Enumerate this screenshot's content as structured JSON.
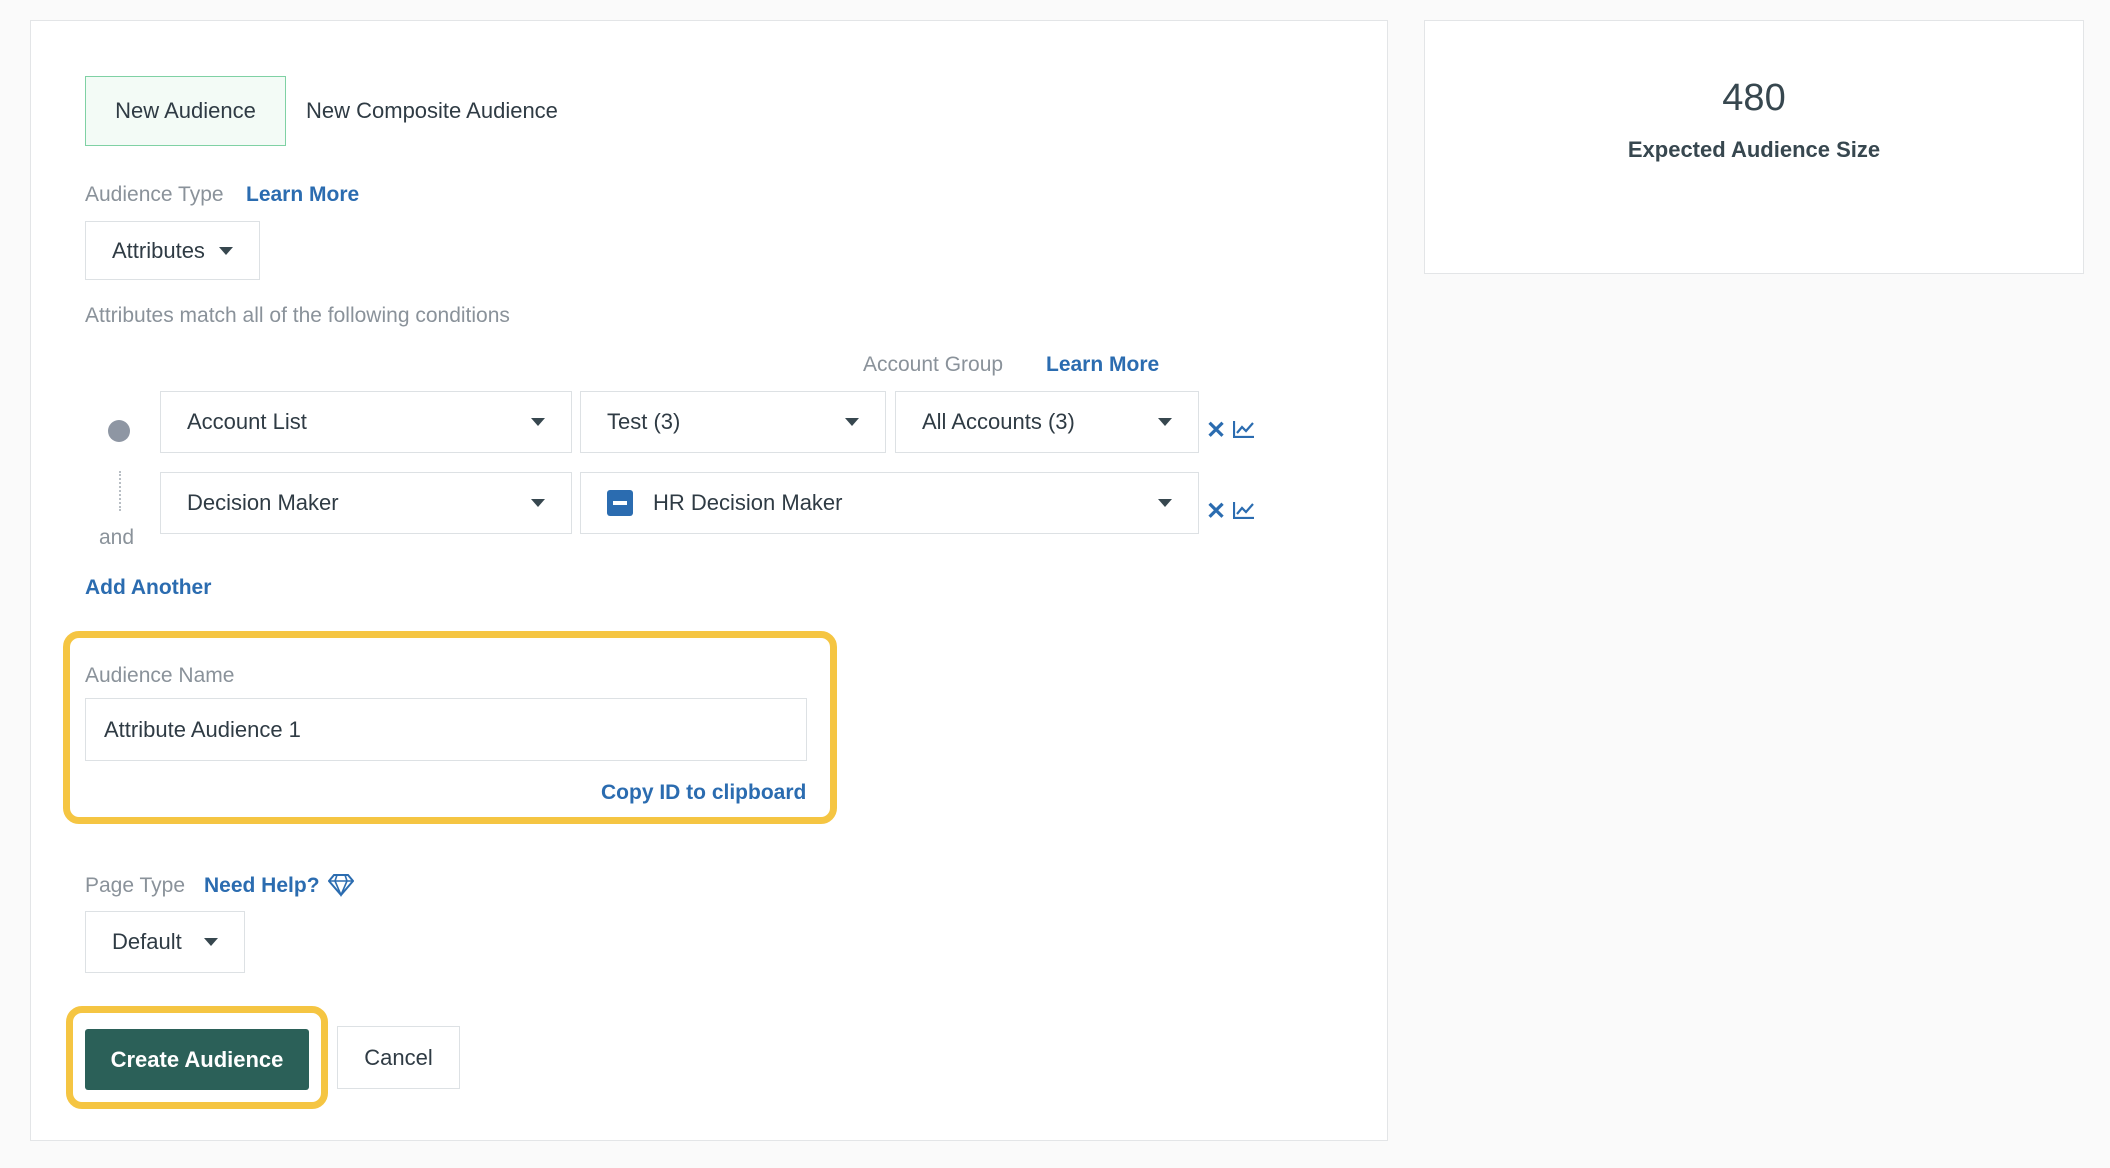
{
  "tabs": {
    "new_audience": "New Audience",
    "new_composite_audience": "New Composite Audience"
  },
  "audience_type": {
    "label": "Audience Type",
    "learn_more": "Learn More",
    "selected": "Attributes"
  },
  "conditions": {
    "description": "Attributes match all of the following conditions",
    "account_group_label": "Account Group",
    "account_group_learn_more": "Learn More",
    "connector": "and",
    "rows": [
      {
        "field": "Account List",
        "value": "Test (3)",
        "group": "All Accounts (3)"
      },
      {
        "field": "Decision Maker",
        "value": "HR Decision Maker"
      }
    ],
    "add_another": "Add Another"
  },
  "audience_name": {
    "label": "Audience Name",
    "value": "Attribute Audience 1",
    "copy_id": "Copy ID to clipboard"
  },
  "page_type": {
    "label": "Page Type",
    "need_help": "Need Help?",
    "selected": "Default"
  },
  "actions": {
    "create": "Create Audience",
    "cancel": "Cancel"
  },
  "summary": {
    "count": "480",
    "label": "Expected Audience Size"
  },
  "colors": {
    "primary_button": "#2b6058",
    "link": "#2b6cb0",
    "highlight": "#f5c542",
    "active_tab_border": "#7fd1a4"
  }
}
